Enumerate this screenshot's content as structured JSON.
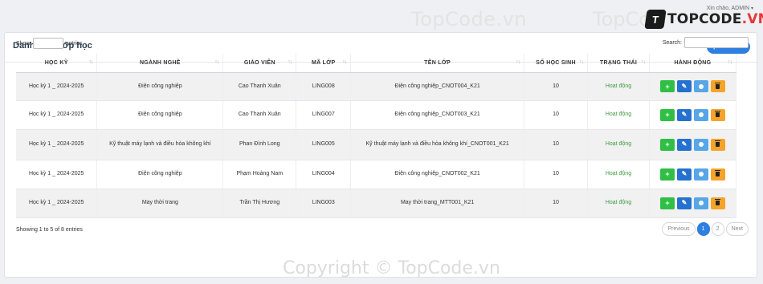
{
  "watermarks": {
    "top_left": "TopCode.vn",
    "top_right": "TopCo",
    "bottom": "Copyright © TopCode.vn"
  },
  "logo": {
    "badge": "T",
    "text_main": "TOPCODE",
    "text_suffix": ".VN"
  },
  "greeting": "Xin chào, ADMIN",
  "card": {
    "title": "Danh sách lớp học",
    "add_label": "Thêm mới"
  },
  "controls": {
    "show_label": "Show",
    "entries_label": "entries",
    "search_label": "Search:"
  },
  "table": {
    "headers": [
      "HỌC KỲ",
      "NGÀNH NGHỀ",
      "GIÁO VIÊN",
      "MÃ LỚP",
      "TÊN LỚP",
      "SỐ HỌC SINH",
      "TRẠNG THÁI",
      "HÀNH ĐỘNG"
    ],
    "rows": [
      [
        "Học kỳ 1 _ 2024-2025",
        "Điện công nghiệp",
        "Cao Thanh Xuân",
        "LING008",
        "Điện công nghiệp_CNOT004_K21",
        "10",
        "Hoạt động"
      ],
      [
        "Học kỳ 1 _ 2024-2025",
        "Điện công nghiệp",
        "Cao Thanh Xuân",
        "LING007",
        "Điện công nghiệp_CNOT003_K21",
        "10",
        "Hoạt động"
      ],
      [
        "Học kỳ 1 _ 2024-2025",
        "Kỹ thuật máy lạnh và điều hòa không khí",
        "Phan Đình Long",
        "LING005",
        "Kỹ thuật máy lạnh và điều hòa không khí_CNOT001_K21",
        "10",
        "Hoạt động"
      ],
      [
        "Học kỳ 1 _ 2024-2025",
        "Điện công nghiệp",
        "Phạm Hoàng Nam",
        "LING004",
        "Điện công nghiệp_CNOT002_K21",
        "10",
        "Hoạt động"
      ],
      [
        "Học kỳ 1 _ 2024-2025",
        "May thời trang",
        "Trần Thị Hương",
        "LING003",
        "May thời trang_MTT001_K21",
        "10",
        "Hoạt động"
      ]
    ]
  },
  "icons": {
    "sort": "sort-icon",
    "add": "plus-icon",
    "edit": "pencil-icon",
    "info": "info-icon",
    "delete": "trash-icon"
  },
  "colors": {
    "primary": "#2d7fe0",
    "green": "#2fbf45",
    "blue": "#2571cf",
    "info": "#56a6e8",
    "orange": "#f6a429",
    "status": "#3f9b3f"
  },
  "footer": {
    "info": "Showing 1 to 5 of 8 entries",
    "previous": "Previous",
    "pages": [
      "1",
      "2"
    ],
    "next": "Next"
  }
}
